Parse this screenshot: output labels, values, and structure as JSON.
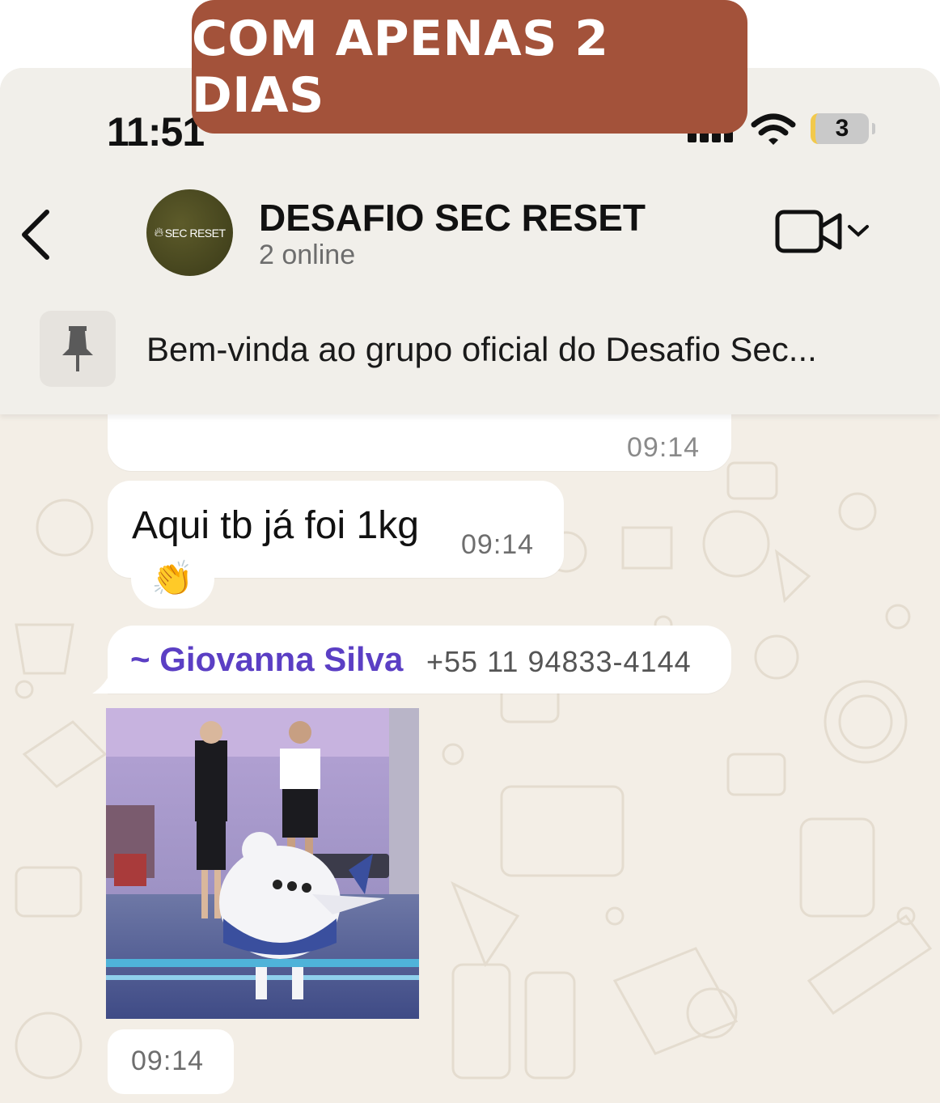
{
  "banner": {
    "text": "COM APENAS 2 DIAS"
  },
  "status_bar": {
    "time": "11:51",
    "battery": "3"
  },
  "header": {
    "avatar_text": "SEC RESET",
    "title": "DESAFIO SEC RESET",
    "subtitle": "2 online"
  },
  "pinned": {
    "text": "Bem-vinda ao grupo oficial do Desafio Sec..."
  },
  "messages": {
    "partial_time": "09:14",
    "text_message": {
      "text": "Aqui tb já foi 1kg",
      "time": "09:14",
      "reaction": "👏"
    },
    "media_message": {
      "sender_name": "~ Giovanna Silva",
      "sender_phone": "+55 11 94833-4144",
      "time": "09:14"
    }
  },
  "colors": {
    "banner": "#a3523a",
    "sender_name": "#5b3fc4",
    "chat_background": "#f3eee6",
    "header_background": "#f1efea"
  },
  "icons": [
    "back-chevron-icon",
    "video-camera-icon",
    "chevron-down-icon",
    "pin-icon",
    "signal-icon",
    "wifi-icon",
    "battery-icon",
    "clapping-hands-emoji"
  ]
}
